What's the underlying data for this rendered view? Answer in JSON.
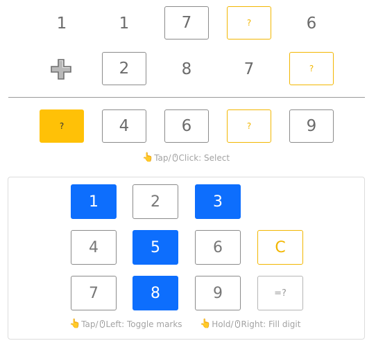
{
  "puzzle": {
    "row1": [
      "1",
      "1",
      "7",
      "?",
      "6"
    ],
    "row2_operator": "plus",
    "row2": [
      "2",
      "8",
      "7",
      "?"
    ],
    "result": [
      "?",
      "4",
      "6",
      "?",
      "9"
    ]
  },
  "hints": {
    "select": "Tap/",
    "select_rest": "Click: Select",
    "toggle": "Tap/",
    "toggle_rest": "Left: Toggle marks",
    "fill": "Hold/",
    "fill_rest": "Right: Fill digit"
  },
  "keypad": {
    "keys": [
      {
        "label": "1",
        "state": "on"
      },
      {
        "label": "2",
        "state": "off"
      },
      {
        "label": "3",
        "state": "on"
      },
      {
        "label": "4",
        "state": "off"
      },
      {
        "label": "5",
        "state": "on"
      },
      {
        "label": "6",
        "state": "off"
      },
      {
        "label": "C",
        "state": "clear"
      },
      {
        "label": "7",
        "state": "off"
      },
      {
        "label": "8",
        "state": "on"
      },
      {
        "label": "9",
        "state": "off"
      },
      {
        "label": "=?",
        "state": "eq"
      }
    ]
  },
  "colors": {
    "accent_blue": "#0d6efd",
    "accent_yellow": "#ffc107",
    "outline_yellow": "#f2b600"
  }
}
